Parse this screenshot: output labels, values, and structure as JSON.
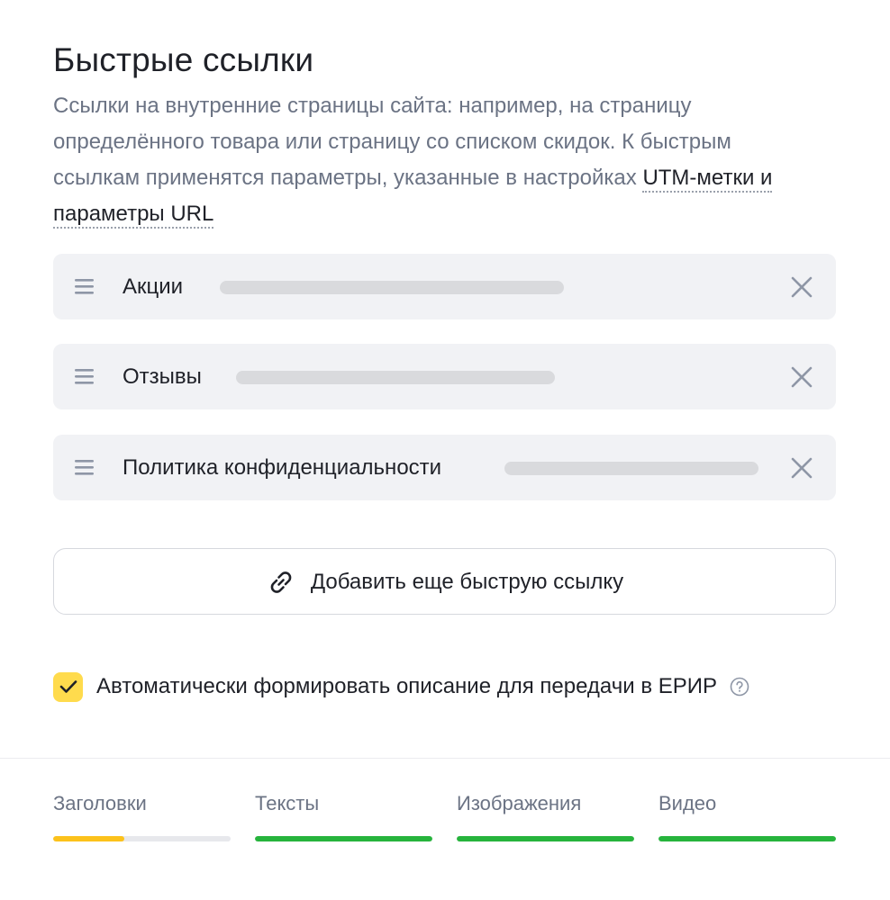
{
  "header": {
    "title": "Быстрые ссылки",
    "description": "Ссылки на внутренние страницы сайта: например, на страницу определённого товара или страницу со списком скидок. К быстрым ссылкам применятся параметры, указанные в настройках ",
    "description_link": "UTM-метки и параметры URL"
  },
  "quick_links": [
    {
      "label": "Акции"
    },
    {
      "label": "Отзывы"
    },
    {
      "label": "Политика конфиденциальности"
    }
  ],
  "add_button": {
    "label": "Добавить еще быструю ссылку"
  },
  "auto_description": {
    "label": "Автоматически формировать описание для передачи в ЕРИР",
    "checked": true
  },
  "tabs": [
    {
      "label": "Заголовки",
      "progress": 0.4,
      "color": "#fcc21b"
    },
    {
      "label": "Тексты",
      "progress": 1.0,
      "color": "#26b43c"
    },
    {
      "label": "Изображения",
      "progress": 1.0,
      "color": "#26b43c"
    },
    {
      "label": "Видео",
      "progress": 1.0,
      "color": "#26b43c"
    }
  ],
  "colors": {
    "accent_yellow": "#ffdb4d",
    "text_secondary": "#6b7384",
    "row_background": "#f1f2f5"
  },
  "icons": {
    "drag": "drag-handle-icon",
    "remove": "close-icon",
    "add": "link-icon",
    "checkbox": "checkmark-icon",
    "help": "question-circle-icon"
  }
}
